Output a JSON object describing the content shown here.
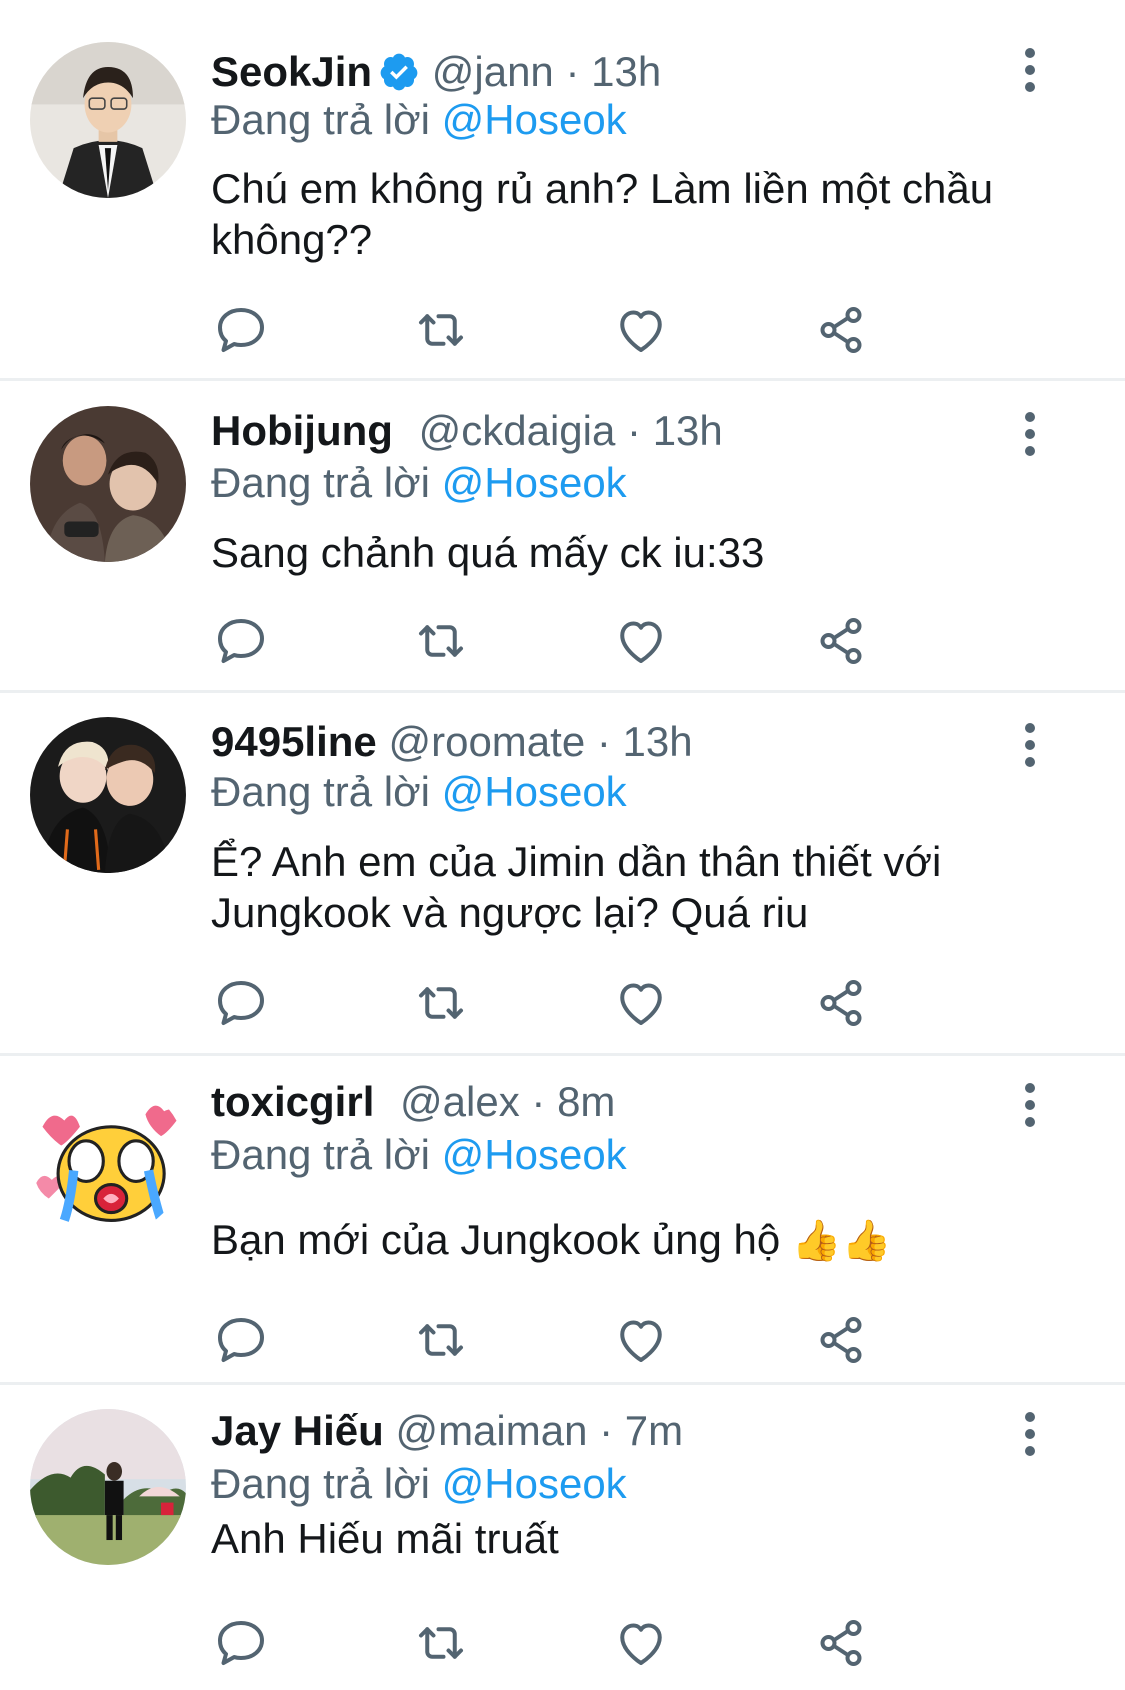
{
  "colors": {
    "accent": "#1d9bf0",
    "text": "#14171a",
    "muted": "#536471",
    "divider": "#eceff1"
  },
  "tweets": [
    {
      "name": "SeokJin",
      "verified": true,
      "handle": "@jann",
      "dot": "·",
      "time": "13h",
      "reply_prefix": "Đang trả lời",
      "reply_to": "@Hoseok",
      "text": "Chú em không rủ anh? Làm liền một chầu không??",
      "avatar": "seokjin-avatar"
    },
    {
      "name": "Hobijung",
      "verified": false,
      "handle": "@ckdaigia",
      "dot": "·",
      "time": "13h",
      "reply_prefix": "Đang trả lời",
      "reply_to": "@Hoseok",
      "text": "Sang chảnh quá mấy ck iu:33",
      "avatar": "hobijung-avatar"
    },
    {
      "name": "9495line",
      "verified": false,
      "handle": "@roomate",
      "dot": "·",
      "time": "13h",
      "reply_prefix": "Đang trả lời",
      "reply_to": "@Hoseok",
      "text": "Ể? Anh em của Jimin dần thân thiết với Jungkook và ngược lại? Quá riu",
      "avatar": "9495line-avatar"
    },
    {
      "name": "toxicgirl",
      "verified": false,
      "handle": "@alex",
      "dot": "·",
      "time": "8m",
      "reply_prefix": "Đang trả lời",
      "reply_to": "@Hoseok",
      "text": "Bạn mới của Jungkook ủng hộ",
      "emoji": "👍👍",
      "avatar": "crying-emoji-avatar"
    },
    {
      "name": "Jay Hiếu",
      "verified": false,
      "handle": "@maiman",
      "dot": "·",
      "time": "7m",
      "reply_prefix": "Đang trả lời",
      "reply_to": "@Hoseok",
      "text": "Anh Hiếu mãi truất",
      "avatar": "jay-hieu-avatar"
    }
  ],
  "icons": {
    "reply": "reply-icon",
    "retweet": "retweet-icon",
    "like": "like-icon",
    "share": "share-icon",
    "more": "more-icon",
    "verified": "verified-badge-icon"
  }
}
